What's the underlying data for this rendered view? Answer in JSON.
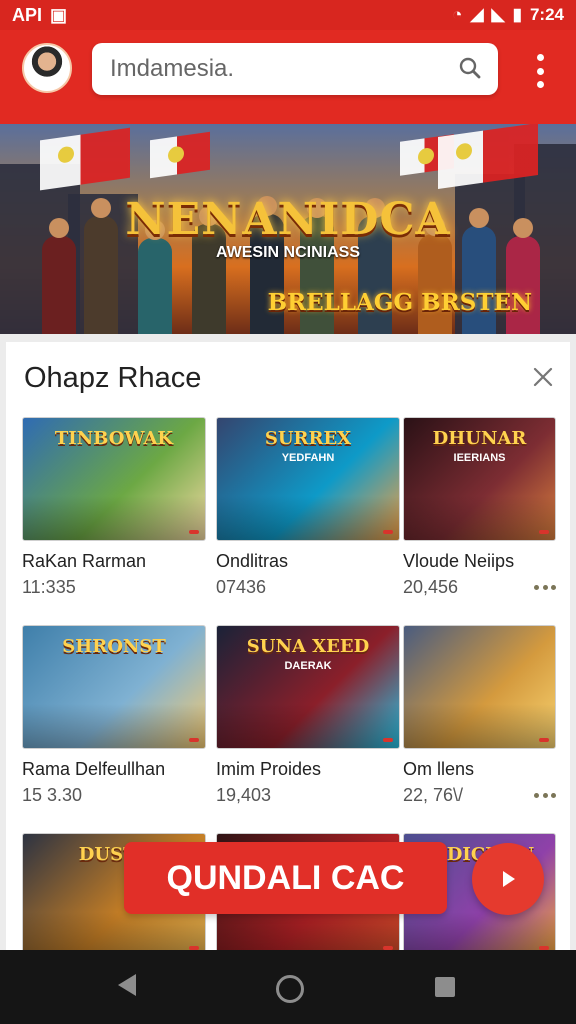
{
  "status": {
    "carrier": "API",
    "time": "7:24"
  },
  "search": {
    "placeholder": "Imdamesia."
  },
  "banner": {
    "title": "NENANIDCA",
    "subtitle": "AWESIN NCINIASS",
    "tag": "BRELLAGG BRSTEN"
  },
  "sheet": {
    "title": "Ohapz Rhace",
    "items": [
      {
        "name": "RaKan Rarman",
        "count": "11:335",
        "art_title": "TINBOWAK",
        "art_subtitle": "",
        "badge": "",
        "colors": [
          "#2f6bb3",
          "#6ca844",
          "#f3d9a3"
        ]
      },
      {
        "name": "Ondlitras",
        "count": "07436",
        "art_title": "SURREX",
        "art_subtitle": "YEDFAHN",
        "badge": "",
        "colors": [
          "#34456f",
          "#0e9ac8",
          "#f39f42"
        ]
      },
      {
        "name": "Vloude Neiips",
        "count": "20,456",
        "art_title": "DHUNAR",
        "art_subtitle": "IEERIANS",
        "badge": "",
        "colors": [
          "#2a1116",
          "#7d2d33",
          "#d97f3e"
        ]
      },
      {
        "name": "Rama Delfeullhan",
        "count": "15 3.30",
        "art_title": "SHRONST",
        "art_subtitle": "",
        "badge": "",
        "colors": [
          "#3f7faa",
          "#7fb1d2",
          "#f4ca72"
        ]
      },
      {
        "name": "Imim Proides",
        "count": "19,403",
        "art_title": "SUNA XEED",
        "art_subtitle": "DAERAK",
        "badge": "",
        "colors": [
          "#1a2238",
          "#8b1f2a",
          "#27c2e5"
        ]
      },
      {
        "name": "Om llens",
        "count": "22, 76\\/",
        "art_title": "",
        "art_subtitle": "",
        "badge": "",
        "colors": [
          "#4a5c7f",
          "#d49a3e",
          "#f8d371"
        ]
      },
      {
        "name": "",
        "count": "",
        "art_title": "DUSTT",
        "art_subtitle": "",
        "badge": "",
        "colors": [
          "#2d3342",
          "#c37d25",
          "#e5b24f"
        ]
      },
      {
        "name": "",
        "count": "",
        "art_title": "",
        "art_subtitle": "",
        "badge": "",
        "colors": [
          "#2f1415",
          "#ad2024",
          "#d24d2a"
        ]
      },
      {
        "name": "",
        "count": "",
        "art_title": "EIDICHUN",
        "art_subtitle": "",
        "badge": "",
        "colors": [
          "#4c4f8f",
          "#8f41a9",
          "#f0a63d"
        ]
      }
    ]
  },
  "cta": {
    "label": "QUNDALI CAC"
  }
}
